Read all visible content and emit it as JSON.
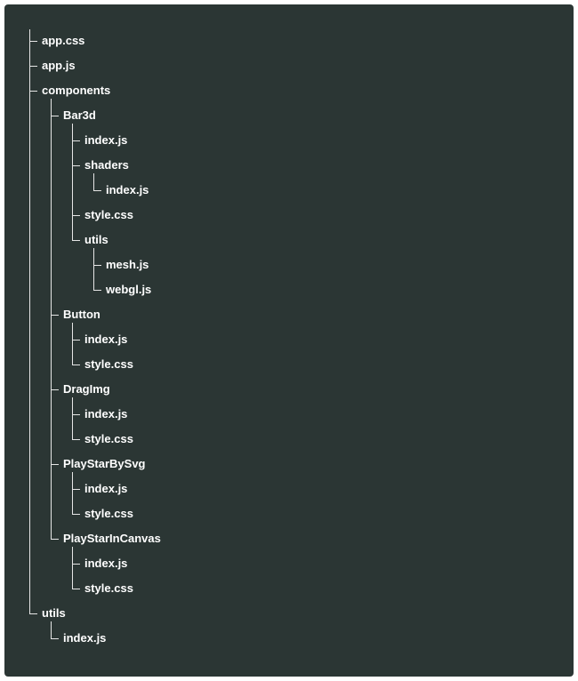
{
  "tree": [
    {
      "name": "app.css"
    },
    {
      "name": "app.js"
    },
    {
      "name": "components",
      "children": [
        {
          "name": "Bar3d",
          "children": [
            {
              "name": "index.js"
            },
            {
              "name": "shaders",
              "children": [
                {
                  "name": "index.js"
                }
              ]
            },
            {
              "name": "style.css"
            },
            {
              "name": "utils",
              "children": [
                {
                  "name": "mesh.js"
                },
                {
                  "name": "webgl.js"
                }
              ]
            }
          ]
        },
        {
          "name": "Button",
          "children": [
            {
              "name": "index.js"
            },
            {
              "name": "style.css"
            }
          ]
        },
        {
          "name": "DragImg",
          "children": [
            {
              "name": "index.js"
            },
            {
              "name": "style.css"
            }
          ]
        },
        {
          "name": "PlayStarBySvg",
          "children": [
            {
              "name": "index.js"
            },
            {
              "name": "style.css"
            }
          ]
        },
        {
          "name": "PlayStarInCanvas",
          "children": [
            {
              "name": "index.js"
            },
            {
              "name": "style.css"
            }
          ]
        }
      ]
    },
    {
      "name": "utils",
      "children": [
        {
          "name": "index.js"
        }
      ]
    }
  ],
  "colors": {
    "background": "#2b3634",
    "text": "#ffffff",
    "line": "#e6e6e6"
  }
}
